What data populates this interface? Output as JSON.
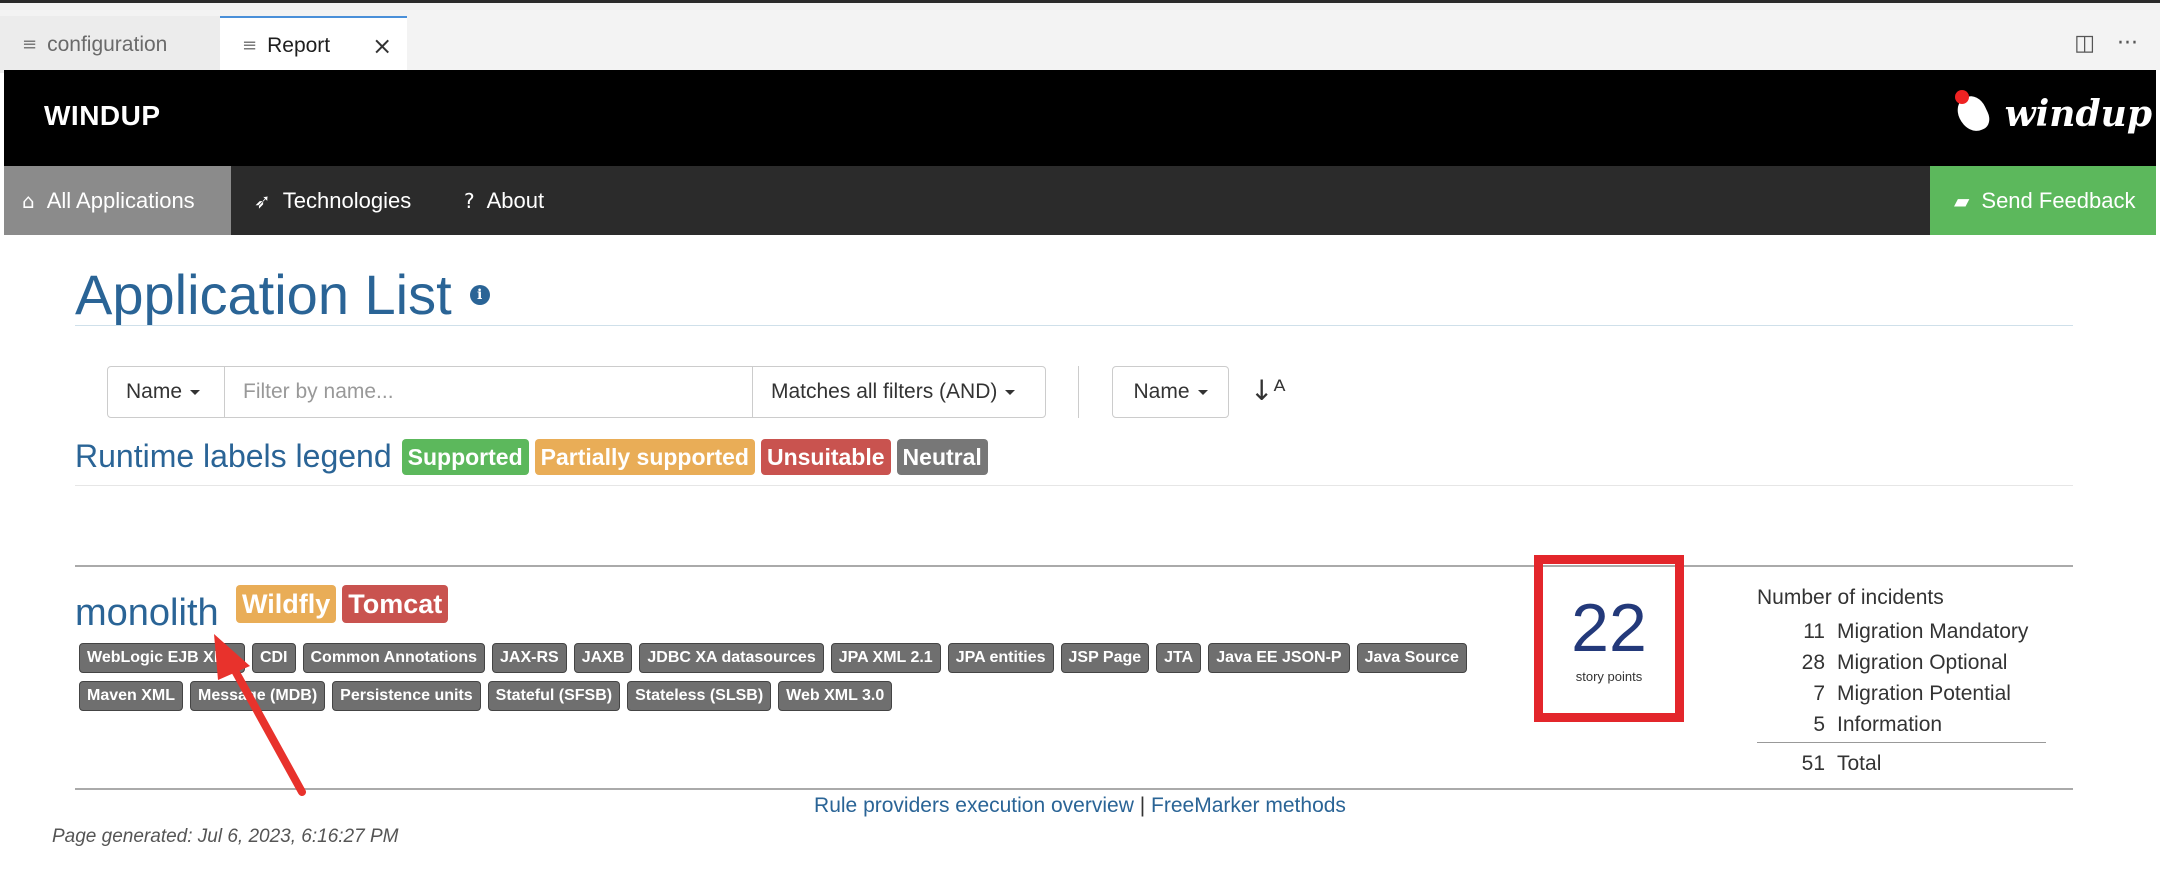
{
  "editor": {
    "tabs": [
      {
        "label": "configuration"
      },
      {
        "label": "Report"
      }
    ]
  },
  "header": {
    "brand": "WINDUP",
    "logo_text": "windup"
  },
  "nav": {
    "items": [
      {
        "label": "All Applications",
        "icon": "home-icon"
      },
      {
        "label": "Technologies",
        "icon": "rocket-icon"
      },
      {
        "label": "About",
        "icon": "question-circle-icon"
      }
    ],
    "feedback": {
      "label": "Send Feedback",
      "icon": "comment-icon"
    }
  },
  "page": {
    "title": "Application List"
  },
  "filter": {
    "field_label": "Name",
    "placeholder": "Filter by name...",
    "match_label": "Matches all filters (AND)",
    "sort_label": "Name"
  },
  "legend": {
    "title": "Runtime labels legend",
    "labels": [
      {
        "text": "Supported",
        "color": "#5cb85c"
      },
      {
        "text": "Partially supported",
        "color": "#e9ad57"
      },
      {
        "text": "Unsuitable",
        "color": "#c9534f"
      },
      {
        "text": "Neutral",
        "color": "#777777"
      }
    ]
  },
  "application": {
    "name": "monolith",
    "runtimes": [
      {
        "text": "Wildfly",
        "color": "#e9ad57"
      },
      {
        "text": "Tomcat",
        "color": "#c9534f"
      }
    ],
    "tags_row1": [
      "WebLogic EJB XML",
      "CDI",
      "Common Annotations",
      "JAX-RS",
      "JAXB",
      "JDBC XA datasources",
      "JPA XML 2.1",
      "JPA entities",
      "JSP Page",
      "JTA",
      "Java EE JSON-P",
      "Java Source"
    ],
    "tags_row2": [
      "Maven XML",
      "Message (MDB)",
      "Persistence units",
      "Stateful (SFSB)",
      "Stateless (SLSB)",
      "Web XML 3.0"
    ],
    "story_points": "22",
    "story_points_label": "story points",
    "incidents_title": "Number of incidents",
    "incidents": [
      {
        "count": "11",
        "label": "Migration Mandatory"
      },
      {
        "count": "28",
        "label": "Migration Optional"
      },
      {
        "count": "7",
        "label": "Migration Potential"
      },
      {
        "count": "5",
        "label": "Information"
      }
    ],
    "total": {
      "count": "51",
      "label": "Total"
    }
  },
  "footer": {
    "link1": "Rule providers execution overview",
    "separator": "|",
    "link2": "FreeMarker methods",
    "generated": "Page generated: Jul 6, 2023, 6:16:27 PM"
  },
  "colors": {
    "brand_blue": "#2a6496",
    "story_highlight": "#e3262b",
    "feedback_green": "#5cb85c"
  }
}
